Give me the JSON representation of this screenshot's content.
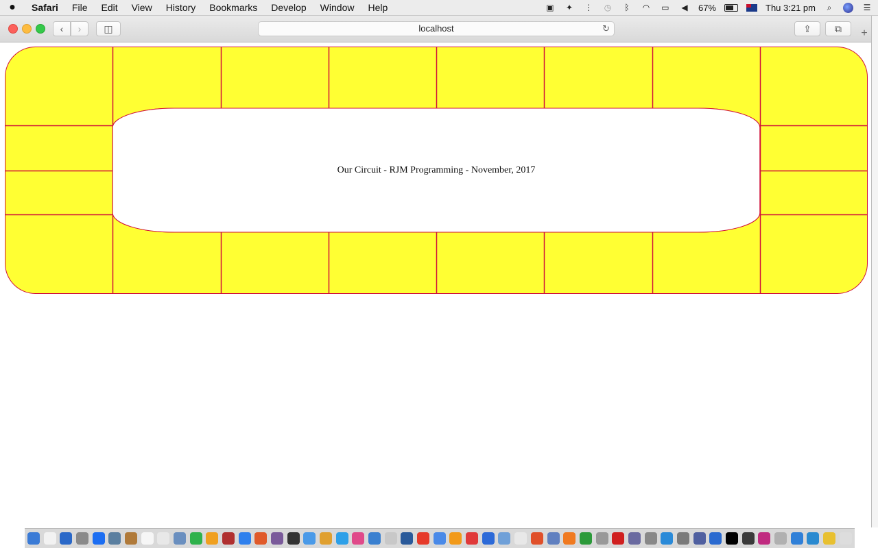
{
  "menubar": {
    "app_name": "Safari",
    "items": [
      "File",
      "Edit",
      "View",
      "History",
      "Bookmarks",
      "Develop",
      "Window",
      "Help"
    ],
    "battery": "67%",
    "clock": "Thu 3:21 pm"
  },
  "toolbar": {
    "address": "localhost"
  },
  "page": {
    "caption": "Our Circuit - RJM Programming - November, 2017"
  },
  "board": {
    "fill_color": "#ffff33",
    "line_color": "#d0103a",
    "top_row_cells": 8,
    "bottom_row_cells": 8,
    "side_rows": 4
  },
  "dock": {
    "colors": [
      "#3b7bd6",
      "#f2f2f2",
      "#2a68c8",
      "#8a8a8a",
      "#1c6ef2",
      "#5b7fa0",
      "#b07a3a",
      "#f6f6f6",
      "#e8e8e8",
      "#6a8fbf",
      "#2fb24c",
      "#f0a020",
      "#b03030",
      "#2f80ed",
      "#e05a2a",
      "#7a5a9a",
      "#333333",
      "#4a9ae8",
      "#e0a030",
      "#2ea0e8",
      "#e04a8a",
      "#3a80d0",
      "#c8c8c8",
      "#2a5a9a",
      "#e63a2a",
      "#4a8ae8",
      "#f29a1a",
      "#e03a3a",
      "#2c6ad8",
      "#6fa0d8",
      "#e8e8e8",
      "#e0502a",
      "#6080c0",
      "#f07a20",
      "#2c9a3a",
      "#999999",
      "#d02020",
      "#6a6aa0",
      "#888888",
      "#2a8ad8",
      "#7a7a7a",
      "#5060a0",
      "#2a6ad0",
      "#000000",
      "#3a3a3a",
      "#c02a80",
      "#b0b0b0",
      "#3080d8",
      "#2a8ad0",
      "#e8c030",
      "#dddddd"
    ]
  }
}
